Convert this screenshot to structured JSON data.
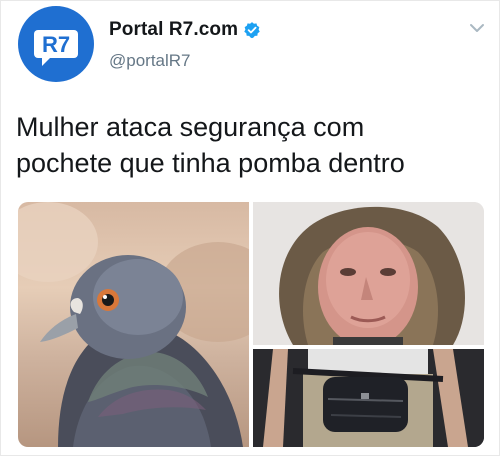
{
  "account": {
    "display_name": "Portal R7.com",
    "handle": "@portalR7",
    "avatar_text": "R7",
    "verified_icon": "verified-badge-icon",
    "brand_color": "#1f6fd1",
    "verified_color": "#1da1f2"
  },
  "tweet": {
    "line1": "Mulher ataca segurança com",
    "line2": "pochete que tinha pomba dentro"
  },
  "media": {
    "images": [
      "pigeon-photo",
      "woman-portrait-photo",
      "waist-pouch-photo"
    ]
  }
}
